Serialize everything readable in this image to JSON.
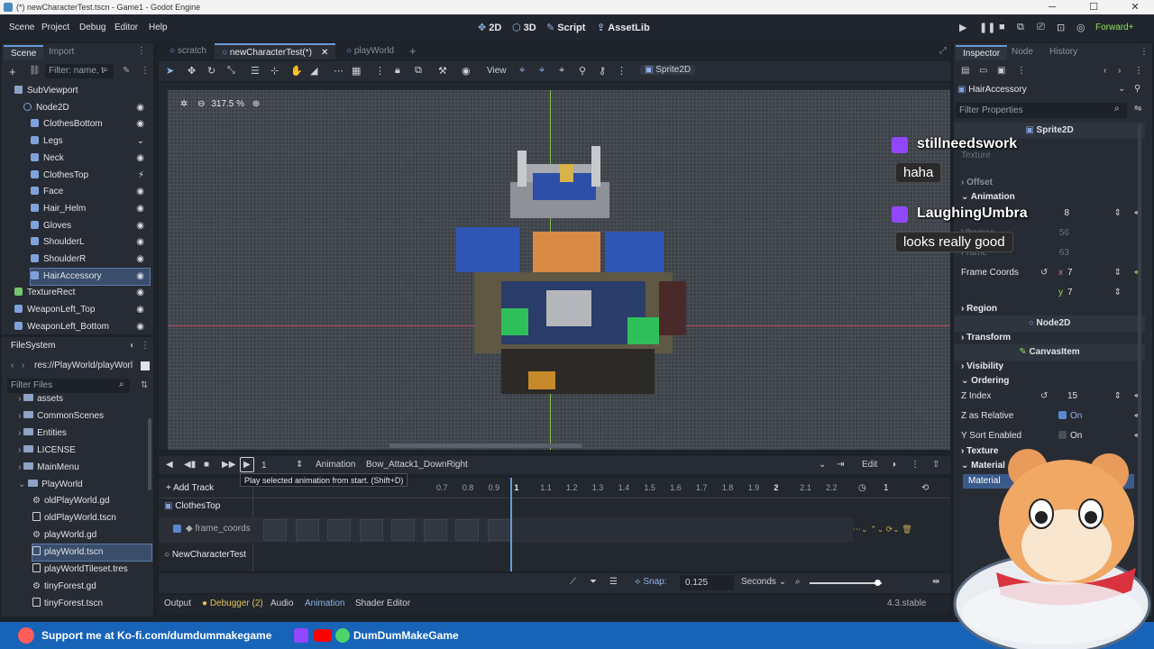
{
  "window": {
    "title": "(*) newCharacterTest.tscn - Game1 - Godot Engine",
    "min": "─",
    "max": "☐",
    "close": "✕"
  },
  "menu": [
    "Scene",
    "Project",
    "Debug",
    "Editor",
    "Help"
  ],
  "workspaces": {
    "w2d": "2D",
    "w3d": "3D",
    "script": "Script",
    "assetlib": "AssetLib"
  },
  "renderer": "Forward+",
  "scene_dock": {
    "tabs": [
      "Scene",
      "Import"
    ],
    "filter_placeholder": "Filter: name, t",
    "nodes": [
      {
        "label": "SubViewport",
        "depth": 1
      },
      {
        "label": "Node2D",
        "depth": 2
      },
      {
        "label": "ClothesBottom",
        "depth": 3
      },
      {
        "label": "Legs",
        "depth": 3
      },
      {
        "label": "Neck",
        "depth": 3
      },
      {
        "label": "ClothesTop",
        "depth": 3
      },
      {
        "label": "Face",
        "depth": 3
      },
      {
        "label": "Hair_Helm",
        "depth": 3
      },
      {
        "label": "Gloves",
        "depth": 3
      },
      {
        "label": "ShoulderL",
        "depth": 3
      },
      {
        "label": "ShoulderR",
        "depth": 3
      },
      {
        "label": "HairAccessory",
        "depth": 3
      },
      {
        "label": "TextureRect",
        "depth": 1
      },
      {
        "label": "WeaponLeft_Top",
        "depth": 1
      },
      {
        "label": "WeaponLeft_Bottom",
        "depth": 1
      }
    ]
  },
  "filesystem": {
    "title": "FileSystem",
    "path": "res://PlayWorld/playWorl",
    "filter_placeholder": "Filter Files",
    "items": [
      {
        "label": "assets",
        "kind": "folder",
        "depth": 1
      },
      {
        "label": "CommonScenes",
        "kind": "folder",
        "depth": 1
      },
      {
        "label": "Entities",
        "kind": "folder",
        "depth": 1
      },
      {
        "label": "LICENSE",
        "kind": "folder",
        "depth": 1
      },
      {
        "label": "MainMenu",
        "kind": "folder",
        "depth": 1
      },
      {
        "label": "PlayWorld",
        "kind": "folder",
        "depth": 1
      },
      {
        "label": "oldPlayWorld.gd",
        "kind": "gear",
        "depth": 2
      },
      {
        "label": "oldPlayWorld.tscn",
        "kind": "file",
        "depth": 2
      },
      {
        "label": "playWorld.gd",
        "kind": "gear",
        "depth": 2
      },
      {
        "label": "playWorld.tscn",
        "kind": "file",
        "depth": 2
      },
      {
        "label": "playWorldTileset.tres",
        "kind": "file",
        "depth": 2
      },
      {
        "label": "tinyForest.gd",
        "kind": "gear",
        "depth": 2
      },
      {
        "label": "tinyForest.tscn",
        "kind": "file",
        "depth": 2
      }
    ]
  },
  "scene_tabs": [
    "scratch",
    "newCharacterTest(*)",
    "playWorld"
  ],
  "viewport": {
    "view_menu": "View",
    "node_chip": "Sprite2D",
    "zoom": "317.5 %"
  },
  "animation": {
    "frame": "1",
    "label": "Animation",
    "name": "Bow_Attack1_DownRight",
    "edit": "Edit",
    "add_track": "+ Add Track",
    "tooltip": "Play selected animation from start. (Shift+D)",
    "ticks": [
      "0.7",
      "0.8",
      "0.9",
      "1",
      "1.1",
      "1.2",
      "1.3",
      "1.4",
      "1.5",
      "1.6",
      "1.7",
      "1.8",
      "1.9",
      "2",
      "2.1",
      "2.2"
    ],
    "length": "1",
    "tracks": [
      {
        "node": "ClothesTop",
        "prop": "frame_coords"
      },
      {
        "node": "NewCharacterTest",
        "prop": ""
      }
    ],
    "snap_label": "Snap:",
    "snap": "0.125",
    "unit": "Seconds"
  },
  "bottom_tabs": [
    "Output",
    "Debugger (2)",
    "Audio",
    "Animation",
    "Shader Editor"
  ],
  "version": "4.3.stable",
  "inspector": {
    "tabs": [
      "Inspector",
      "Node",
      "History"
    ],
    "object": "HairAccessory",
    "filter_placeholder": "Filter Properties",
    "class_sprite": "Sprite2D",
    "texture": "Texture",
    "offset": "Offset",
    "animation": "Animation",
    "hframes": "8",
    "vframes": "Vframes",
    "vframes_val": "56",
    "frame": "Frame",
    "frame_val": "63",
    "frame_coords": "Frame Coords",
    "fc_x_label": "x",
    "fc_x": "7",
    "fc_y_label": "y",
    "fc_y": "7",
    "region": "Region",
    "class_node2d": "Node2D",
    "transform": "Transform",
    "class_canvas": "CanvasItem",
    "visibility": "Visibility",
    "ordering": "Ordering",
    "z_index": "Z Index",
    "z_index_val": "15",
    "z_relative": "Z as Relative",
    "z_relative_val": "On",
    "y_sort": "Y Sort Enabled",
    "y_sort_val": "On",
    "texture2": "Texture",
    "material": "Material",
    "material_val": "Material"
  },
  "chat": [
    {
      "user": "stillneedswork",
      "msg": "haha"
    },
    {
      "user": "LaughingUmbra",
      "msg": "looks really good"
    }
  ],
  "banner": {
    "kofi": "Support me at Ko-fi.com/dumdummakegame",
    "channel": "DumDumMakeGame"
  }
}
